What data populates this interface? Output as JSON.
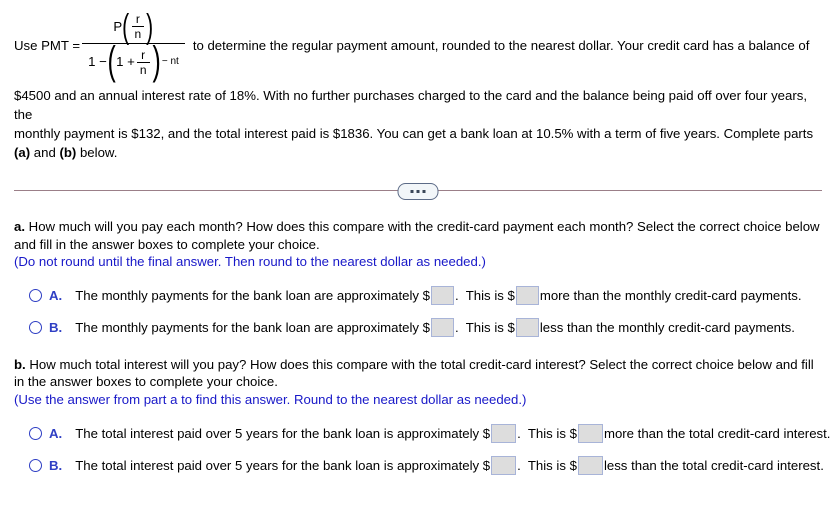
{
  "problem": {
    "formula": {
      "lead_label": "Use PMT =",
      "numerator_P": "P",
      "numerator_frac_top": "r",
      "numerator_frac_bottom": "n",
      "denominator_one_minus": "1 −",
      "denominator_inner_one_plus": "1 +",
      "denominator_frac_top": "r",
      "denominator_frac_bottom": "n",
      "exponent": "− nt"
    },
    "tail_text": "to determine the regular payment amount, rounded to the nearest dollar. Your credit card has a balance of",
    "body_line_1_pre": "$4500 and an annual interest rate of 18%.  With no further purchases charged to the card and the balance being paid off over four years, the",
    "body_line_2_pre": "monthly payment is $132, and the total interest paid is $1836.  You can get a bank loan at 10.5% with a term of five years. Complete parts",
    "body_line_3_a": "(a)",
    "body_line_3_and": " and ",
    "body_line_3_b": "(b)",
    "body_line_3_tail": " below."
  },
  "divider": {
    "dots_icon": "ellipsis-icon"
  },
  "parts": [
    {
      "letter": "a.",
      "prompt_line_1": " How much will you pay each month? How does this compare with the credit-card payment each month? Select the correct choice below",
      "prompt_line_2": "and fill in the answer boxes to complete your choice.",
      "hint": "(Do not round until the final answer. Then round to the nearest dollar as needed.)",
      "choices": [
        {
          "letter": "A.",
          "seg_1": "The monthly payments for the bank loan are approximately $",
          "seg_2": ".  This is $",
          "seg_3": "more than the monthly credit-card payments.",
          "value_1": "",
          "value_2": ""
        },
        {
          "letter": "B.",
          "seg_1": "The monthly payments for the bank loan are approximately $",
          "seg_2": ".  This is $",
          "seg_3": "less than the monthly credit-card payments.",
          "value_1": "",
          "value_2": ""
        }
      ]
    },
    {
      "letter": "b.",
      "prompt_line_1": " How much total interest will you pay? How does this compare with the total credit-card interest? Select the correct choice below and fill",
      "prompt_line_2": "in the answer boxes to complete your choice.",
      "hint": "(Use the answer from part a to find this answer. Round to the nearest dollar as needed.)",
      "choices": [
        {
          "letter": "A.",
          "seg_1": "The total interest paid over 5 years for the bank loan is approximately $",
          "seg_2": ".  This is $",
          "seg_3": "more than the total credit-card interest.",
          "value_1": "",
          "value_2": ""
        },
        {
          "letter": "B.",
          "seg_1": "The total interest paid over 5 years for the bank loan is approximately $",
          "seg_2": ".  This is $",
          "seg_3": "less than the total credit-card interest.",
          "value_1": "",
          "value_2": ""
        }
      ]
    }
  ],
  "colors": {
    "hint_blue": "#1818c8",
    "choice_blue": "#2f3fc4",
    "divider": "#9b7f88",
    "answer_box_fill": "#dddddd",
    "answer_box_border": "#a8b4d8"
  }
}
